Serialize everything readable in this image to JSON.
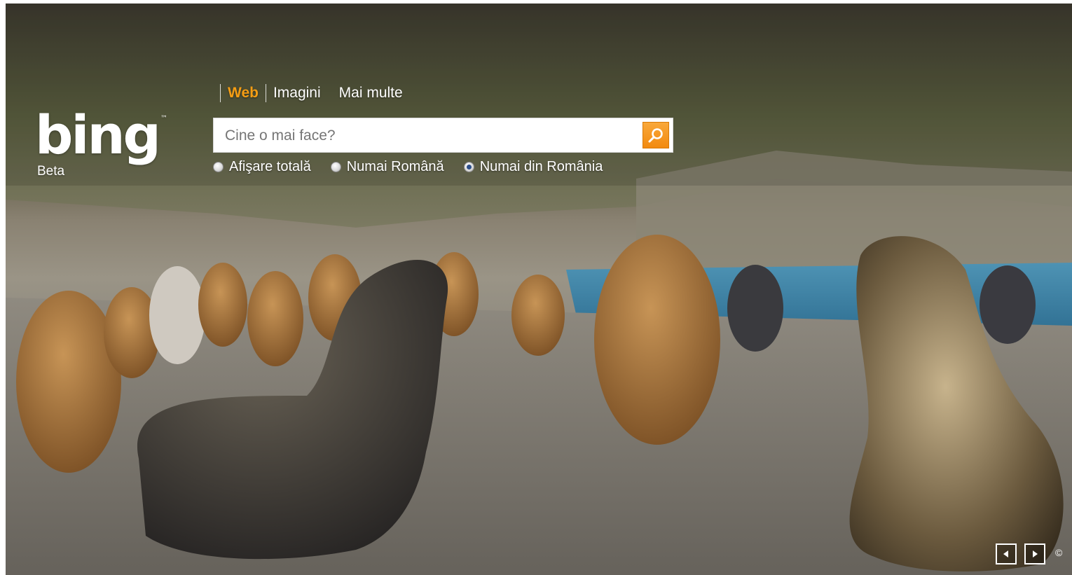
{
  "logo": {
    "text": "bing",
    "trademark": "™",
    "subtitle": "Beta"
  },
  "scopes": {
    "items": [
      {
        "label": "Web",
        "active": true
      },
      {
        "label": "Imagini",
        "active": false
      },
      {
        "label": "Mai multe",
        "active": false
      }
    ]
  },
  "search": {
    "placeholder": "Cine o mai face?",
    "value": "",
    "button_icon": "search-icon"
  },
  "filters": {
    "options": [
      {
        "label": "Afişare totală",
        "checked": false
      },
      {
        "label": "Numai Română",
        "checked": false
      },
      {
        "label": "Numai din România",
        "checked": true
      }
    ]
  },
  "background": {
    "subject": "fur seals and king penguin chicks on a rocky beach",
    "nav_icons": [
      "previous-arrow-icon",
      "next-arrow-icon"
    ],
    "copyright_symbol": "©"
  },
  "colors": {
    "accent": "#f49d14",
    "search_button": "#f28a0f",
    "text": "#ffffff"
  }
}
